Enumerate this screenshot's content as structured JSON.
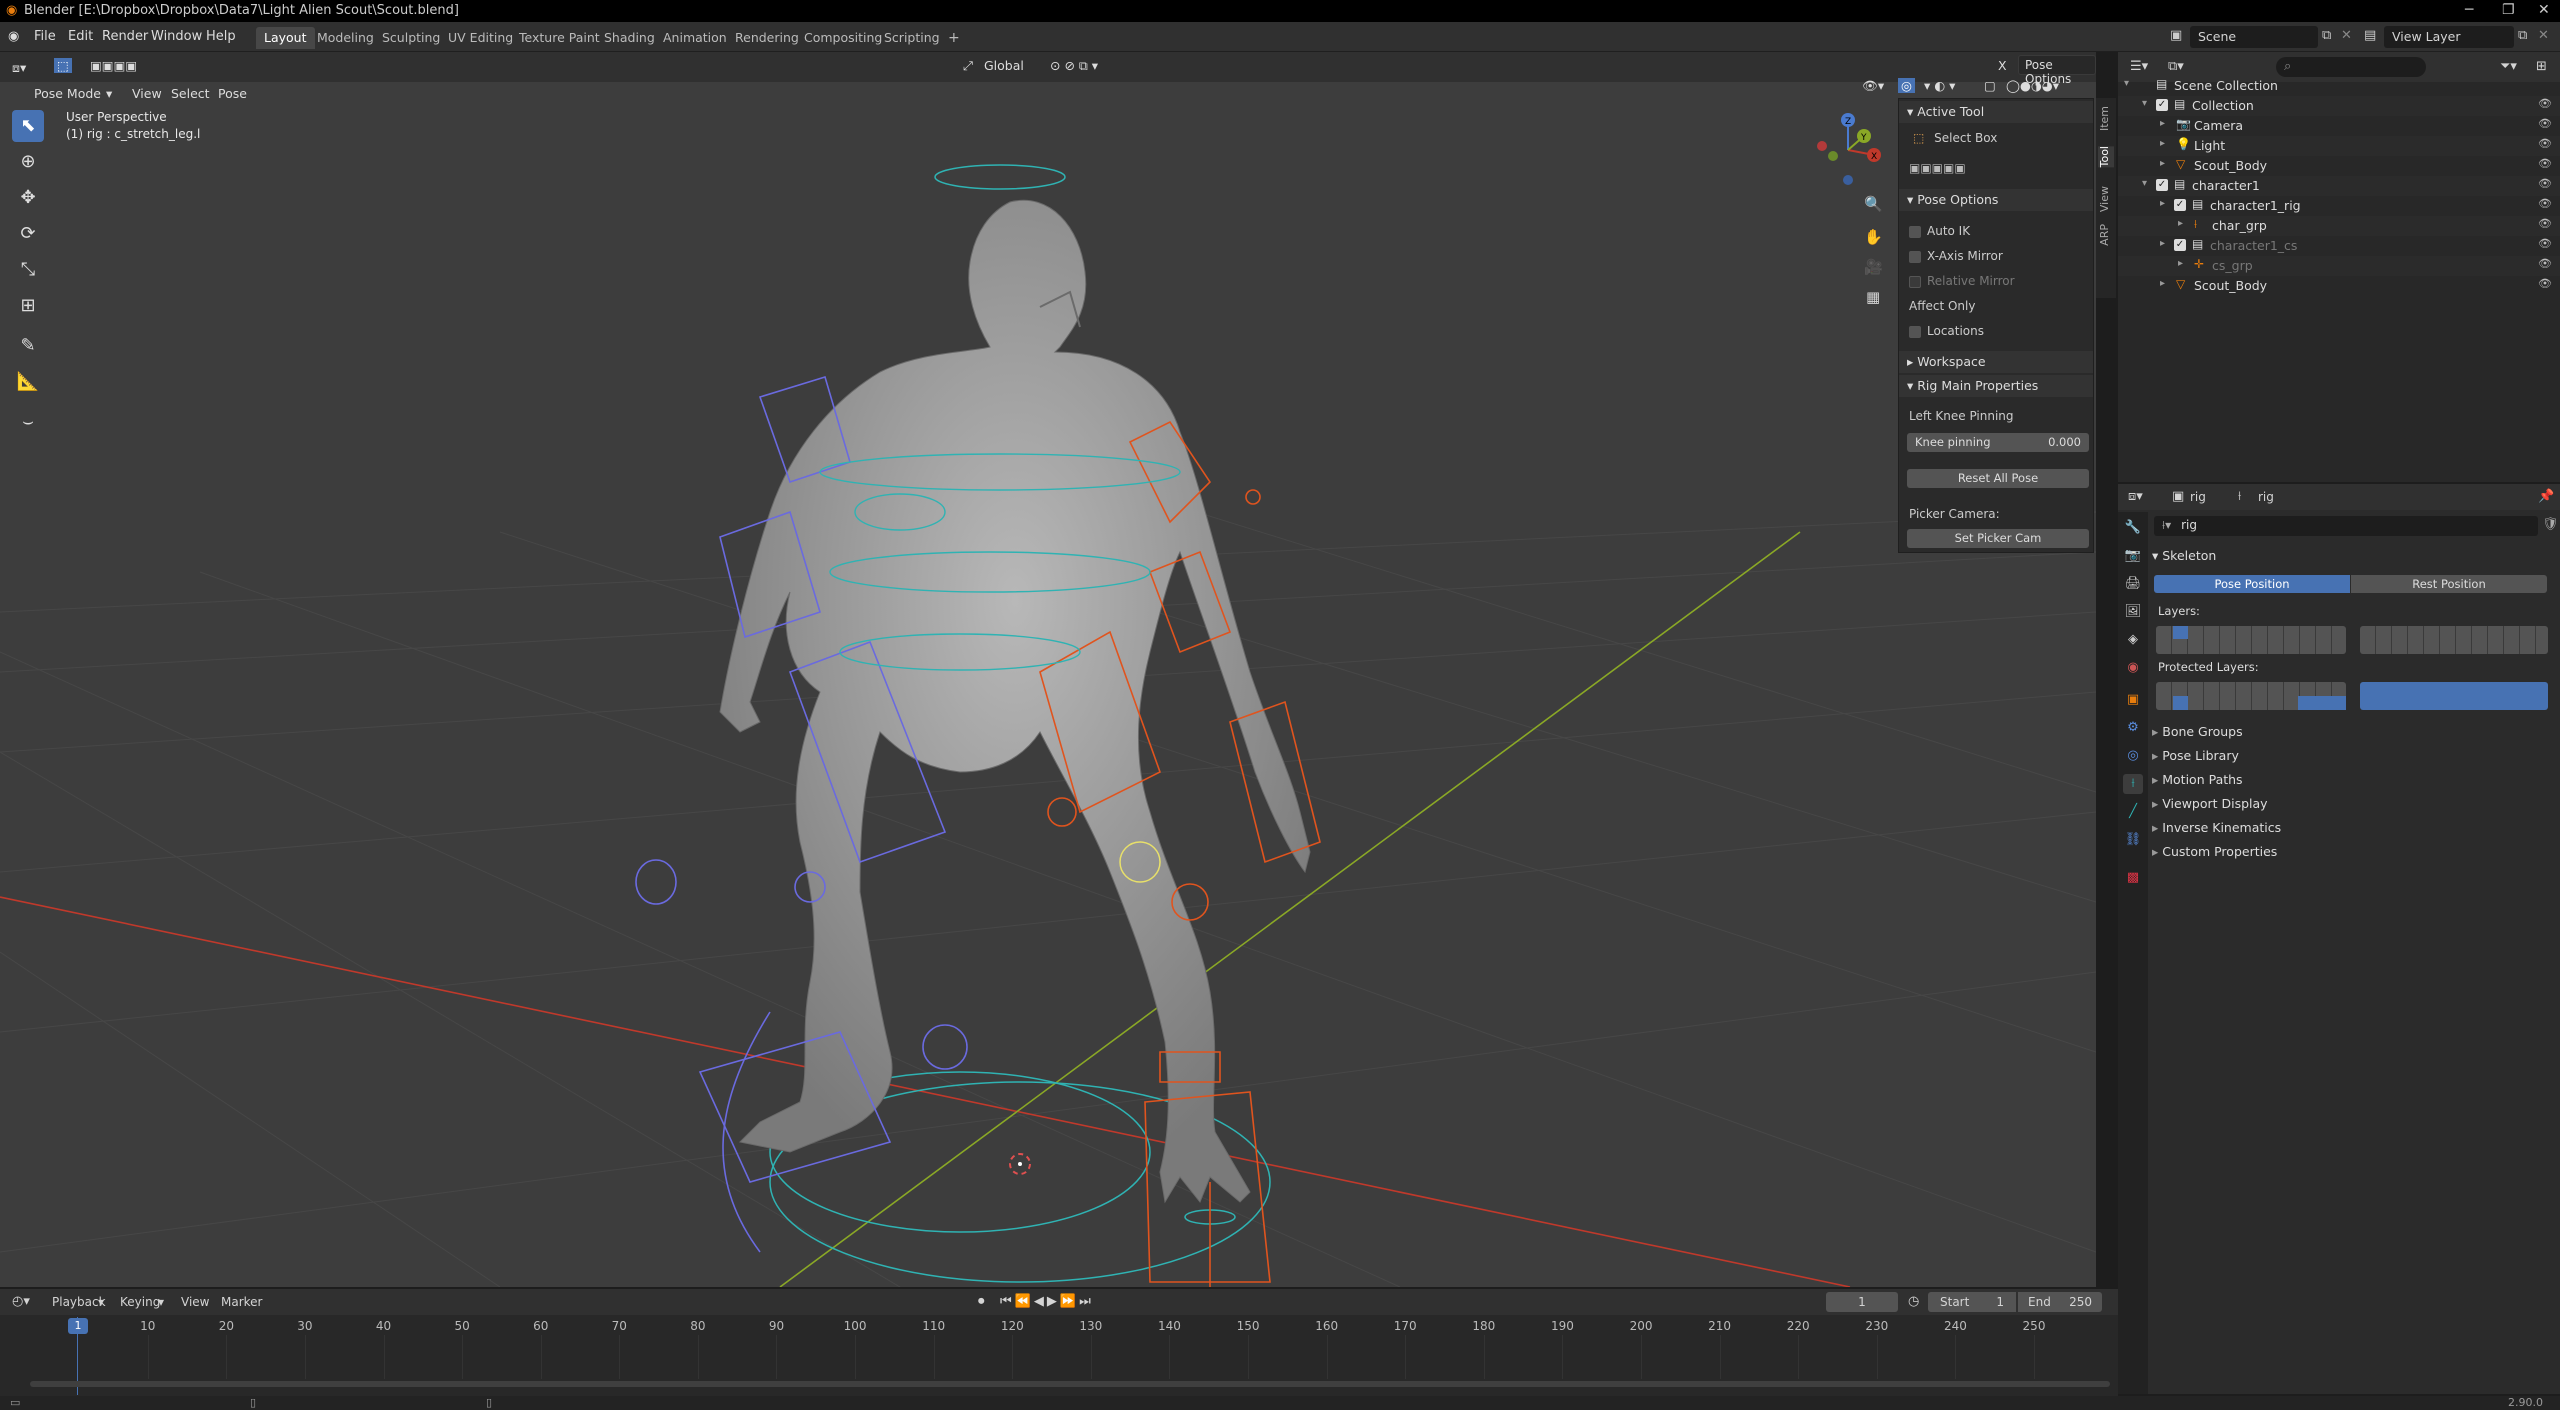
{
  "window": {
    "title": "Blender [E:\\Dropbox\\Dropbox\\Data7\\Light Alien Scout\\Scout.blend]"
  },
  "menu": {
    "file": "File",
    "edit": "Edit",
    "render": "Render",
    "window": "Window",
    "help": "Help"
  },
  "workspaces": [
    "Layout",
    "Modeling",
    "Sculpting",
    "UV Editing",
    "Texture Paint",
    "Shading",
    "Animation",
    "Rendering",
    "Compositing",
    "Scripting"
  ],
  "scene": {
    "name": "Scene",
    "view_layer": "View Layer"
  },
  "viewport": {
    "mode": "Pose Mode",
    "menus": [
      "View",
      "Select",
      "Pose"
    ],
    "orientation": "Global",
    "pose_options": "Pose Options",
    "overlay_title": "User Perspective",
    "overlay_subtitle": "(1) rig : c_stretch_leg.l",
    "gizmo": {
      "x": "X",
      "y": "Y",
      "z": "Z"
    }
  },
  "npanel": {
    "tabs": [
      "Item",
      "Tool",
      "View",
      "ARP"
    ],
    "active_tool_header": "Active Tool",
    "active_tool": "Select Box",
    "pose_options_header": "Pose Options",
    "auto_ik": "Auto IK",
    "x_axis_mirror": "X-Axis Mirror",
    "relative_mirror": "Relative Mirror",
    "affect_only": "Affect Only",
    "locations": "Locations",
    "workspace_header": "Workspace",
    "rig_header": "Rig Main Properties",
    "left_knee": "Left Knee Pinning",
    "knee_label": "Knee pinning",
    "knee_value": "0.000",
    "reset_btn": "Reset All Pose",
    "picker_label": "Picker Camera:",
    "set_picker_btn": "Set Picker Cam"
  },
  "outliner": {
    "rows": [
      {
        "name": "Scene Collection",
        "indent": 0,
        "icon": "collection",
        "color": "#dddddd"
      },
      {
        "name": "Collection",
        "indent": 1,
        "icon": "collection",
        "color": "#dddddd"
      },
      {
        "name": "Camera",
        "indent": 2,
        "icon": "camera",
        "color": "#dddddd"
      },
      {
        "name": "Light",
        "indent": 2,
        "icon": "light",
        "color": "#dddddd"
      },
      {
        "name": "Scout_Body",
        "indent": 2,
        "icon": "mesh",
        "color": "#dddddd"
      },
      {
        "name": "character1",
        "indent": 1,
        "icon": "collection",
        "color": "#dddddd"
      },
      {
        "name": "character1_rig",
        "indent": 2,
        "icon": "collection",
        "color": "#dddddd"
      },
      {
        "name": "char_grp",
        "indent": 3,
        "icon": "armature",
        "color": "#dddddd"
      },
      {
        "name": "character1_cs",
        "indent": 2,
        "icon": "collection",
        "color": "#777777"
      },
      {
        "name": "cs_grp",
        "indent": 3,
        "icon": "empty",
        "color": "#777777"
      },
      {
        "name": "Scout_Body",
        "indent": 2,
        "icon": "mesh",
        "color": "#dddddd"
      }
    ]
  },
  "properties": {
    "obj1": "rig",
    "obj2": "rig",
    "search_value": "rig",
    "skeleton": "Skeleton",
    "pose_position": "Pose Position",
    "rest_position": "Rest Position",
    "layers": "Layers:",
    "protected_layers": "Protected Layers:",
    "sections": [
      "Bone Groups",
      "Pose Library",
      "Motion Paths",
      "Viewport Display",
      "Inverse Kinematics",
      "Custom Properties"
    ]
  },
  "timeline": {
    "menus": [
      "Playback",
      "Keying",
      "View",
      "Marker"
    ],
    "current_frame": "1",
    "start_label": "Start",
    "start": "1",
    "end_label": "End",
    "end": "250",
    "ticks": [
      "1",
      "10",
      "20",
      "30",
      "40",
      "50",
      "60",
      "70",
      "80",
      "90",
      "100",
      "110",
      "120",
      "130",
      "140",
      "150",
      "160",
      "170",
      "180",
      "190",
      "200",
      "210",
      "220",
      "230",
      "240",
      "250"
    ]
  },
  "status": {
    "version": "2.90.0"
  },
  "colors": {
    "accent": "#4772b3",
    "x_axis": "#c0392b",
    "y_axis": "#8aa826",
    "rig_orange": "#e0541e",
    "rig_blue": "#6a6adf",
    "rig_cyan": "#2fb3b3"
  }
}
